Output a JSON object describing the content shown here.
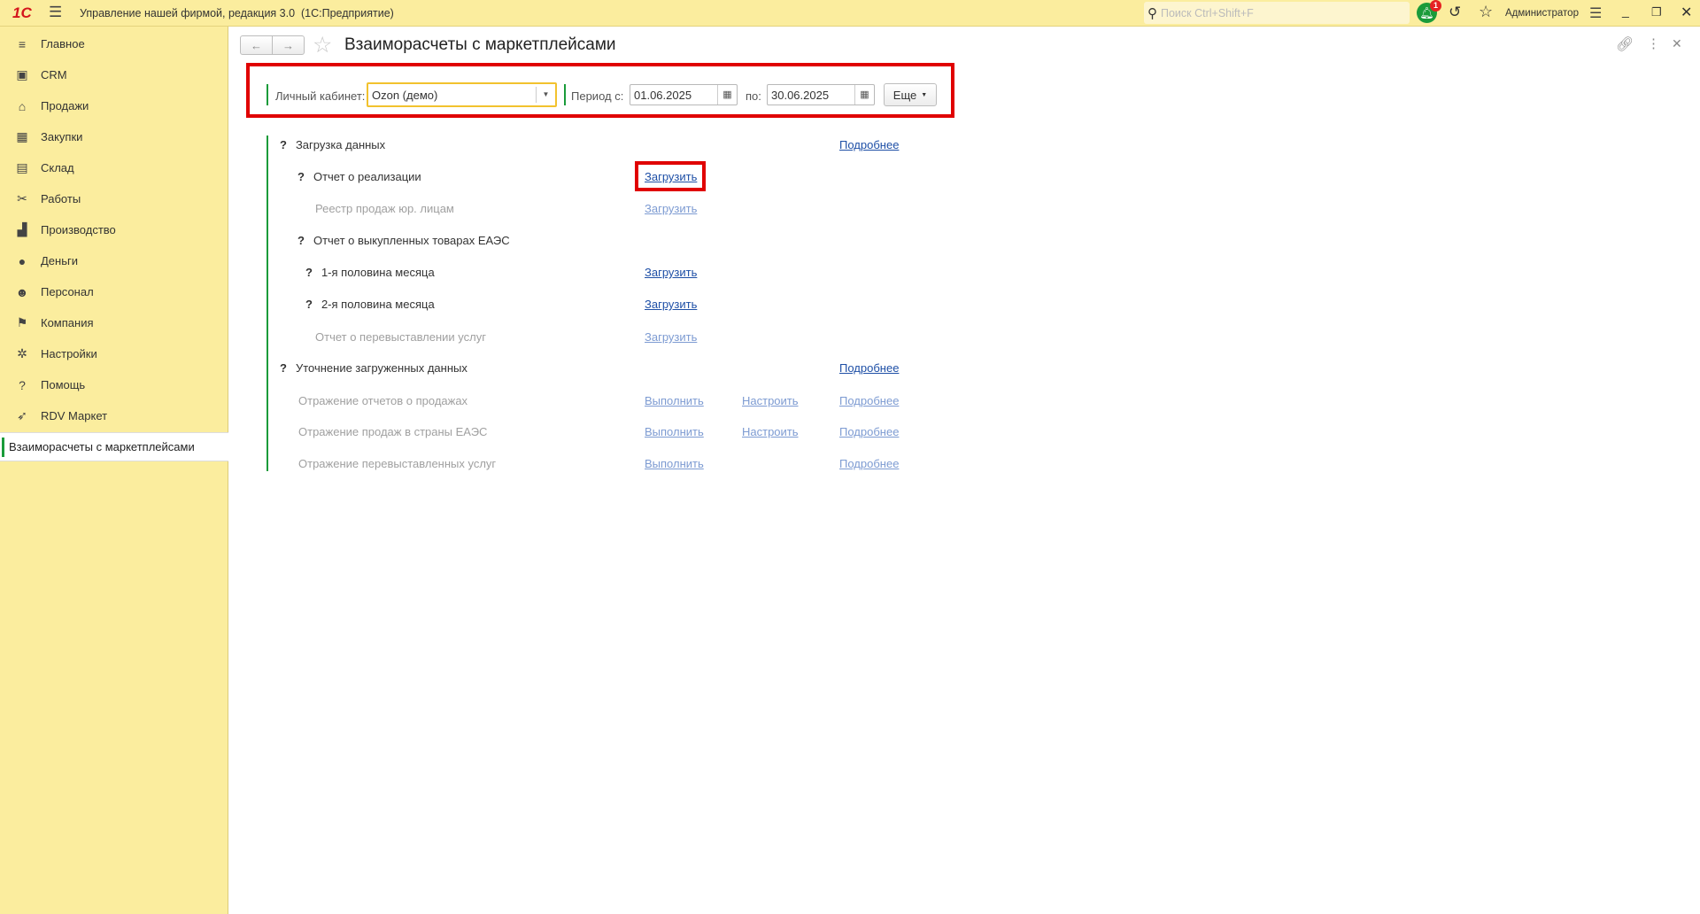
{
  "app": {
    "title": "Управление нашей фирмой, редакция 3.0  (1С:Предприятие)",
    "logo": "1С",
    "search_placeholder": "Поиск Ctrl+Shift+F",
    "notifications_count": "1",
    "user": "Администратор"
  },
  "sidebar": {
    "items": [
      {
        "label": "Главное",
        "icon": "≡"
      },
      {
        "label": "CRM",
        "icon": "▣"
      },
      {
        "label": "Продажи",
        "icon": "⌂"
      },
      {
        "label": "Закупки",
        "icon": "▦"
      },
      {
        "label": "Склад",
        "icon": "▤"
      },
      {
        "label": "Работы",
        "icon": "✂"
      },
      {
        "label": "Производство",
        "icon": "▟"
      },
      {
        "label": "Деньги",
        "icon": "●"
      },
      {
        "label": "Персонал",
        "icon": "☻"
      },
      {
        "label": "Компания",
        "icon": "⚑"
      },
      {
        "label": "Настройки",
        "icon": "✲"
      },
      {
        "label": "Помощь",
        "icon": "?"
      },
      {
        "label": "RDV Маркет",
        "icon": "➶"
      }
    ],
    "open_window": "Взаиморасчеты с маркетплейсами"
  },
  "page": {
    "title": "Взаиморасчеты с маркетплейсами"
  },
  "filters": {
    "account_label": "Личный кабинет:",
    "account_value": "Ozon (демо)",
    "period_from_label": "Период с:",
    "period_from": "01.06.2025",
    "period_to_label": "по:",
    "period_to": "30.06.2025",
    "more_label": "Еще"
  },
  "colors": {
    "accent_green": "#1a9b3a",
    "highlight_red": "#e00000",
    "link": "#1e4fa6"
  },
  "rows": [
    {
      "label": "Загрузка данных",
      "q": "?",
      "more": "Подробнее"
    },
    {
      "label": "Отчет о реализации",
      "q": "?",
      "action": "Загрузить"
    },
    {
      "label": "Реестр продаж юр. лицам",
      "action": "Загрузить"
    },
    {
      "label": "Отчет о выкупленных товарах ЕАЭС",
      "q": "?"
    },
    {
      "label": "1-я половина месяца",
      "q": "?",
      "action": "Загрузить"
    },
    {
      "label": "2-я половина месяца",
      "q": "?",
      "action": "Загрузить"
    },
    {
      "label": "Отчет о перевыставлении услуг",
      "action": "Загрузить"
    },
    {
      "label": "Уточнение загруженных данных",
      "q": "?",
      "more": "Подробнее"
    },
    {
      "label": "Отражение отчетов о продажах",
      "action": "Выполнить",
      "setup": "Настроить",
      "more": "Подробнее"
    },
    {
      "label": "Отражение продаж в страны ЕАЭС",
      "action": "Выполнить",
      "setup": "Настроить",
      "more": "Подробнее"
    },
    {
      "label": "Отражение перевыставленных услуг",
      "action": "Выполнить",
      "more": "Подробнее"
    }
  ]
}
